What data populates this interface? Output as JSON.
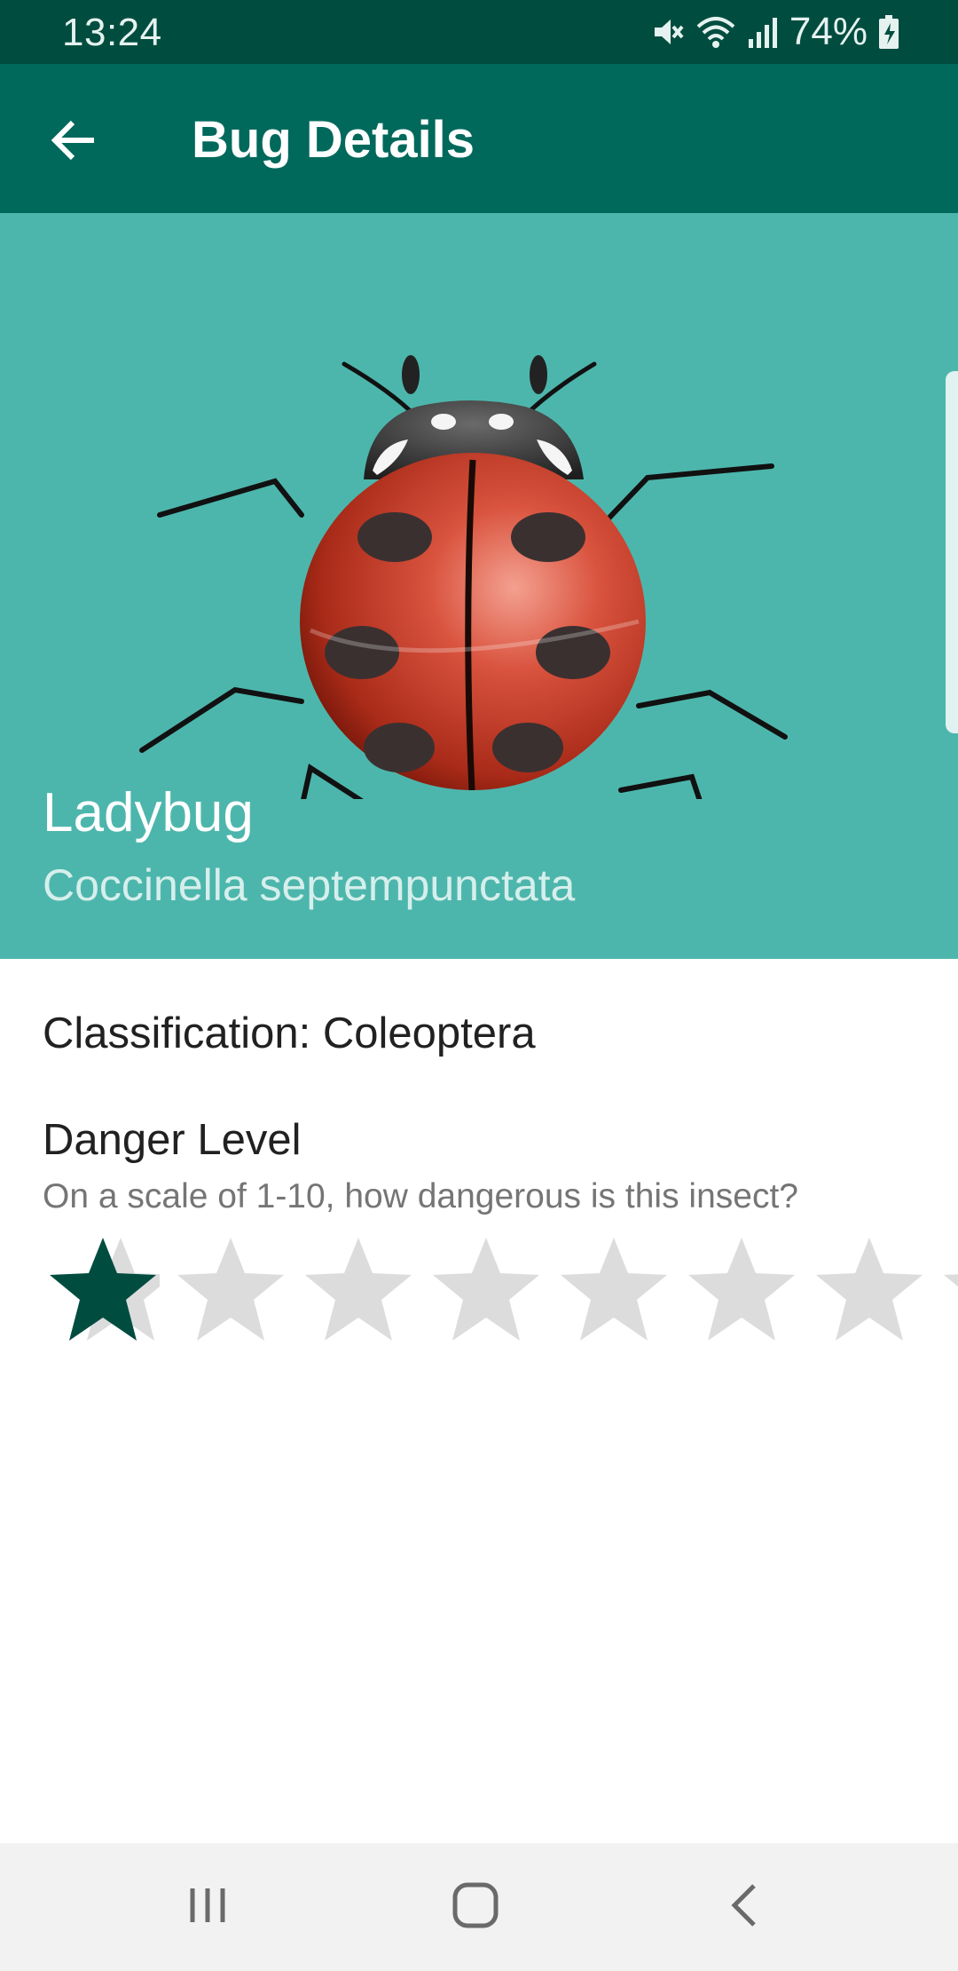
{
  "status_bar": {
    "time": "13:24",
    "battery": "74%",
    "icons": [
      "mute-icon",
      "wifi-icon",
      "signal-icon",
      "battery-charging-icon"
    ]
  },
  "app_bar": {
    "title": "Bug Details",
    "back_icon": "arrow-back-icon"
  },
  "bug": {
    "name": "Ladybug",
    "scientific_name": "Coccinella septempunctata",
    "image": "ladybug-illustration"
  },
  "details": {
    "classification": "Classification: Coleoptera",
    "danger_title": "Danger Level",
    "danger_subtitle": "On a scale of 1-10, how dangerous is this insect?"
  },
  "rating": {
    "value": 1,
    "max": 10,
    "visible_stars": 8
  },
  "colors": {
    "status_bar": "#004d40",
    "app_bar": "#00695c",
    "hero": "#4db6ac",
    "star_filled": "#004d40",
    "star_empty": "#dcdcdc"
  },
  "nav_bar": {
    "icons": [
      "recent-apps-icon",
      "home-icon",
      "back-icon"
    ]
  }
}
